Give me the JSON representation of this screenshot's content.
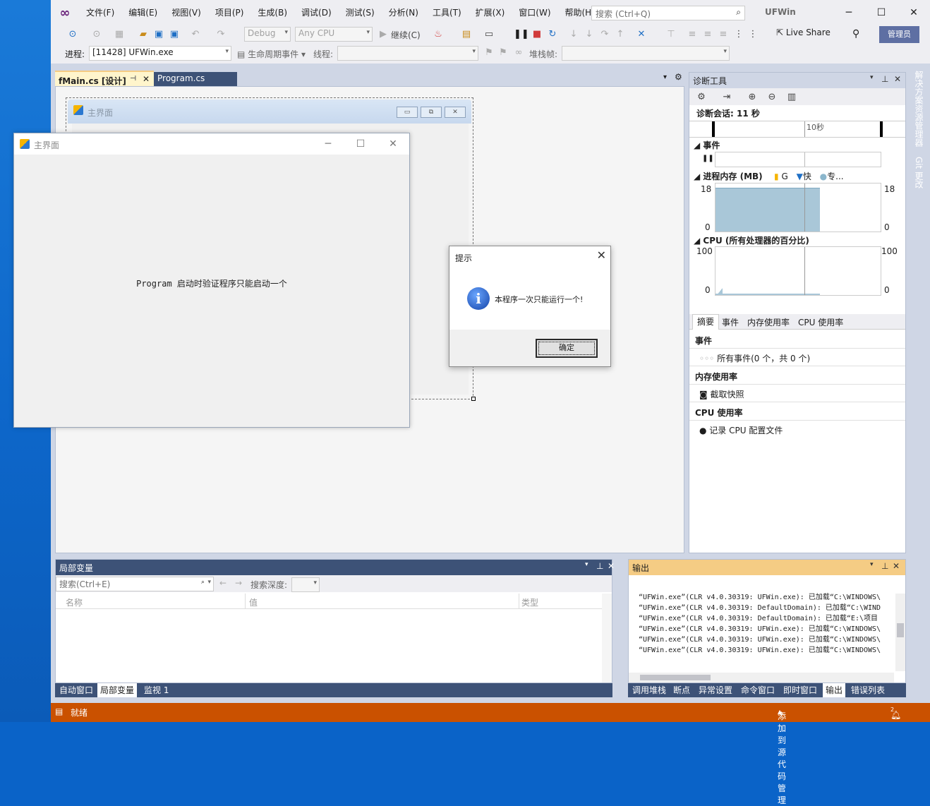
{
  "menubar": {
    "items": [
      "文件(F)",
      "编辑(E)",
      "视图(V)",
      "项目(P)",
      "生成(B)",
      "调试(D)",
      "测试(S)",
      "分析(N)",
      "工具(T)",
      "扩展(X)",
      "窗口(W)",
      "帮助(H)"
    ],
    "search_placeholder": "搜索 (Ctrl+Q)",
    "window_title": "UFWin"
  },
  "toolbar": {
    "config": "Debug",
    "platform": "Any CPU",
    "continue_label": "继续(C)",
    "live_share": "Live Share",
    "admin": "管理员",
    "process_label": "进程:",
    "process_value": "[11428] UFWin.exe",
    "lifecycle_label": "生命周期事件",
    "thread_label": "线程:",
    "stackframe_label": "堆栈帧:"
  },
  "tabs": {
    "active": "fMain.cs [设计]",
    "second": "Program.cs"
  },
  "designer": {
    "form_caption": "主界面"
  },
  "main_window": {
    "caption": "主界面",
    "message": "Program 启动时验证程序只能启动一个"
  },
  "dialog": {
    "caption": "提示",
    "message": "本程序一次只能运行一个!",
    "ok": "确定"
  },
  "diagnostics": {
    "title": "诊断工具",
    "session": "诊断会话: 11 秒",
    "timeline_tick": "10秒",
    "events_label": "事件",
    "memory_label": "进程内存 (MB)",
    "memory_legend": [
      "G",
      "快",
      "专..."
    ],
    "mem_max": "18",
    "mem_min": "0",
    "cpu_label": "CPU (所有处理器的百分比)",
    "cpu_max": "100",
    "cpu_min": "0",
    "tabs": [
      "摘要",
      "事件",
      "内存使用率",
      "CPU 使用率"
    ],
    "summary_events_header": "事件",
    "summary_events_item": "所有事件(0 个，共 0 个)",
    "summary_memory_header": "内存使用率",
    "summary_memory_item": "截取快照",
    "summary_cpu_header": "CPU 使用率",
    "summary_cpu_item": "记录 CPU 配置文件"
  },
  "side_tabs": [
    "解决方案资源管理器",
    "Git 更改"
  ],
  "locals": {
    "title": "局部变量",
    "search_placeholder": "搜索(Ctrl+E)",
    "depth_label": "搜索深度:",
    "columns": [
      "名称",
      "值",
      "类型"
    ],
    "bottom_tabs": [
      "自动窗口",
      "局部变量",
      "监视 1"
    ]
  },
  "output": {
    "title": "输出",
    "lines": [
      "“UFWin.exe”(CLR v4.0.30319: UFWin.exe): 已加载“C:\\WINDOWS\\",
      "“UFWin.exe”(CLR v4.0.30319: DefaultDomain): 已加载“C:\\WIND",
      "“UFWin.exe”(CLR v4.0.30319: DefaultDomain): 已加载“E:\\项目",
      "“UFWin.exe”(CLR v4.0.30319: UFWin.exe): 已加载“C:\\WINDOWS\\",
      "“UFWin.exe”(CLR v4.0.30319: UFWin.exe): 已加载“C:\\WINDOWS\\",
      "“UFWin.exe”(CLR v4.0.30319: UFWin.exe): 已加载“C:\\WINDOWS\\"
    ],
    "bottom_tabs": [
      "调用堆栈",
      "断点",
      "异常设置",
      "命令窗口",
      "即时窗口",
      "输出",
      "错误列表"
    ]
  },
  "status": {
    "text": "就绪",
    "source_control": "添加到源代码管理",
    "notifications": "2"
  },
  "colors": {
    "statusbar": "#ca5100",
    "panel_header": "#3d5277",
    "output_header": "#f5cc84",
    "memory_fill": "#a9c7d8"
  }
}
